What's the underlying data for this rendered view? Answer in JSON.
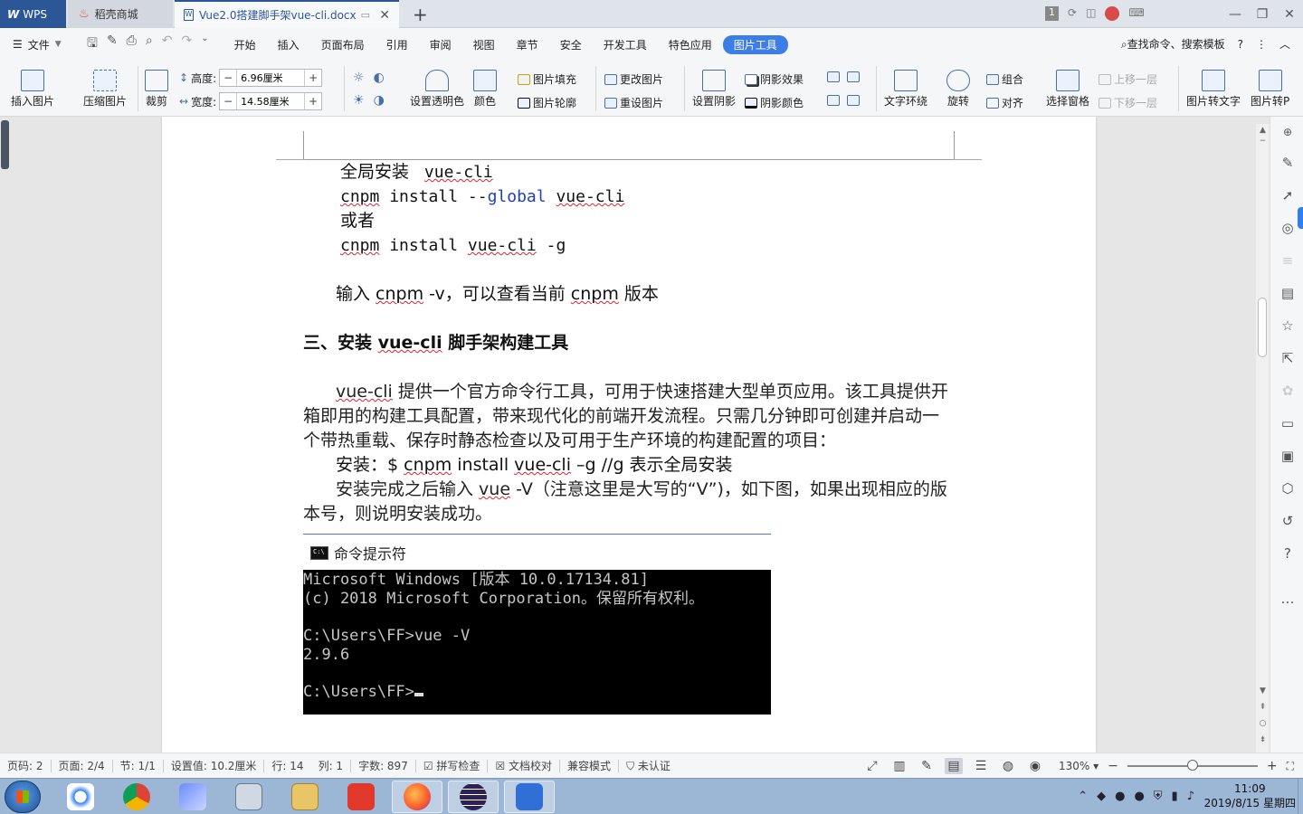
{
  "tabs": {
    "wps": "WPS",
    "daoke": "稻壳商城",
    "doc": "Vue2.0搭建脚手架vue-cli.docx",
    "add": "+",
    "close": "✕",
    "badge": "1"
  },
  "menu": {
    "file": "文件",
    "items": [
      "开始",
      "插入",
      "页面布局",
      "引用",
      "审阅",
      "视图",
      "章节",
      "安全",
      "开发工具",
      "特色应用",
      "图片工具"
    ],
    "active": "图片工具",
    "search": "查找命令、搜索模板",
    "help": "?"
  },
  "ribbon": {
    "insert_picture": "插入图片",
    "compress": "压缩图片",
    "crop": "裁剪",
    "height_label": "高度:",
    "height_value": "6.96厘米",
    "width_label": "宽度:",
    "width_value": "14.58厘米",
    "transparent": "设置透明色",
    "color": "颜色",
    "fill": "图片填充",
    "outline": "图片轮廓",
    "change": "更改图片",
    "reset": "重设图片",
    "shadow_set": "设置阴影",
    "shadow_effect": "阴影效果",
    "shadow_color": "阴影颜色",
    "wrap": "文字环绕",
    "rotate": "旋转",
    "group": "组合",
    "align": "对齐",
    "select_pane": "选择窗格",
    "up_layer": "上移一层",
    "down_layer": "下移一层",
    "to_text": "图片转文字",
    "to_pdf": "图片转P"
  },
  "document": {
    "line1_label": "全局安装",
    "line1_code": "vue-cli",
    "line2": {
      "cmd": "cnpm",
      "rest": " install --",
      "flag": "global",
      "pkg": "vue-cli"
    },
    "line3": "或者",
    "line4": {
      "cmd": "cnpm",
      "rest": " install ",
      "pkg": "vue-cli",
      "opt": " -g"
    },
    "line5": {
      "pre": "输入 ",
      "cmd": "cnpm",
      "mid": " -v，可以查看当前 ",
      "cmd2": "cnpm",
      "post": " 版本"
    },
    "heading": {
      "pre": "三、安装 ",
      "code": "vue-cli",
      "post": " 脚手架构建工具"
    },
    "para1": {
      "code": "vue-cli",
      "text": " 提供一个官方命令行工具，可用于快速搭建大型单页应用。该工具提供开箱即用的构建工具配置，带来现代化的前端开发流程。只需几分钟即可创建并启动一个带热重载、保存时静态检查以及可用于生产环境的构建配置的项目："
    },
    "install_line": {
      "pre": "安装：$ ",
      "cmd": "cnpm",
      "mid": " install ",
      "pkg": "vue-cli",
      "post": " –g         //g 表示全局安装"
    },
    "para2": {
      "pre": "安装完成之后输入 ",
      "code": "vue",
      "post": " -V（注意这里是大写的“V”)，如下图，如果出现相应的版本号，则说明安装成功。"
    },
    "cmd_title": "命令提示符",
    "console_lines": [
      "Microsoft Windows [版本 10.0.17134.81]",
      "(c) 2018 Microsoft Corporation。保留所有权利。",
      "",
      "C:\\Users\\FF>vue -V",
      "2.9.6",
      "",
      "C:\\Users\\FF>"
    ]
  },
  "status": {
    "page_code": "页码: 2",
    "page": "页面: 2/4",
    "section": "节: 1/1",
    "setting": "设置值: 10.2厘米",
    "row": "行: 14",
    "col": "列: 1",
    "words": "字数: 897",
    "spell": "拼写检查",
    "proof": "文档校对",
    "compat": "兼容模式",
    "cert": "未认证",
    "zoom": "130%"
  },
  "taskbar": {
    "time": "11:09",
    "date": "2019/8/15 星期四"
  }
}
